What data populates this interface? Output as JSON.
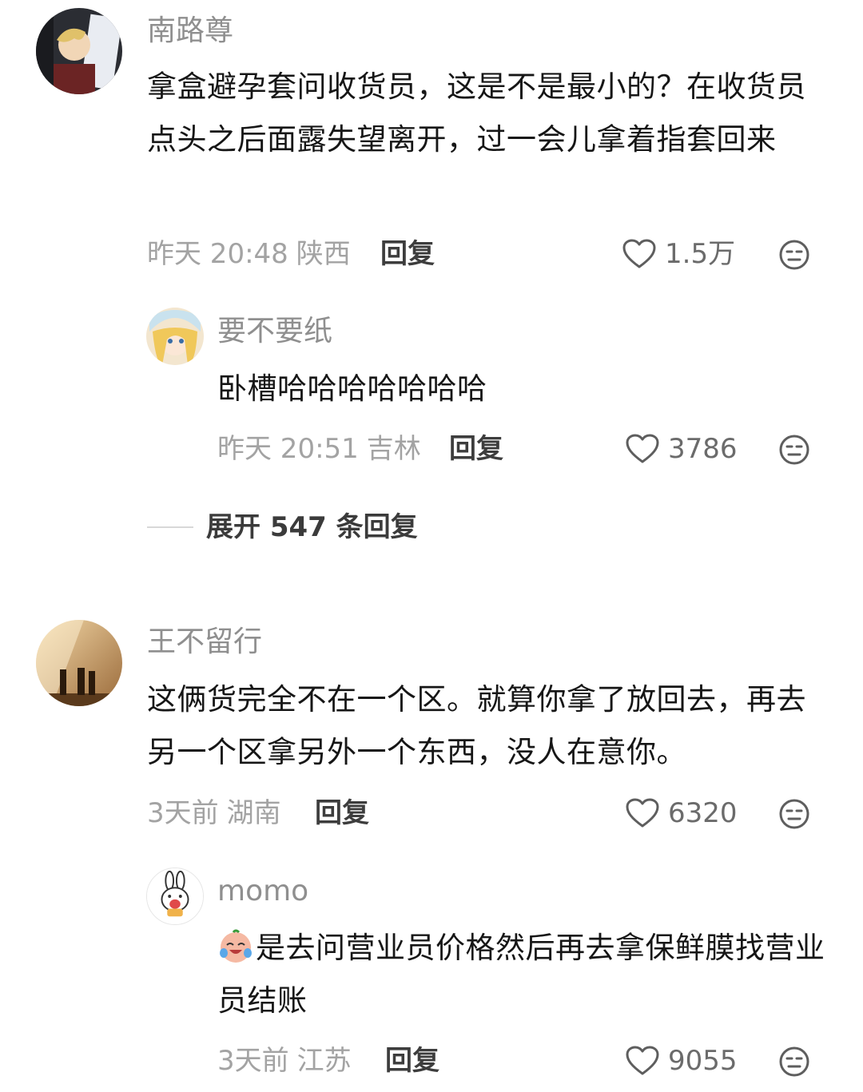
{
  "comments": [
    {
      "username": "南路尊",
      "text": "拿盒避孕套问收货员，这是不是最小的？在收货员点头之后面露失望离开，过一会儿拿着指套回来",
      "time": "昨天 20:48",
      "location": "陕西",
      "reply_label": "回复",
      "likes": "1.5万",
      "replies": [
        {
          "username": "要不要纸",
          "text": "卧槽哈哈哈哈哈哈哈",
          "time": "昨天 20:51",
          "location": "吉林",
          "reply_label": "回复",
          "likes": "3786"
        }
      ],
      "expand_label": "展开 547 条回复"
    },
    {
      "username": "王不留行",
      "text": "这俩货完全不在一个区。就算你拿了放回去，再去另一个区拿另外一个东西，没人在意你。",
      "time": "3天前",
      "location": "湖南",
      "reply_label": "回复",
      "likes": "6320",
      "replies": [
        {
          "username": "momo",
          "text": "是去问营业员价格然后再去拿保鲜膜找营业员结账",
          "time": "3天前",
          "location": "江苏",
          "reply_label": "回复",
          "likes": "9055"
        }
      ]
    }
  ],
  "icons": {
    "like": "heart-outline-icon",
    "dislike": "meh-face-icon"
  },
  "colors": {
    "username": "#8f8f8f",
    "text": "#161616",
    "meta": "#a3a3a3",
    "reply": "#3d3d3d"
  }
}
